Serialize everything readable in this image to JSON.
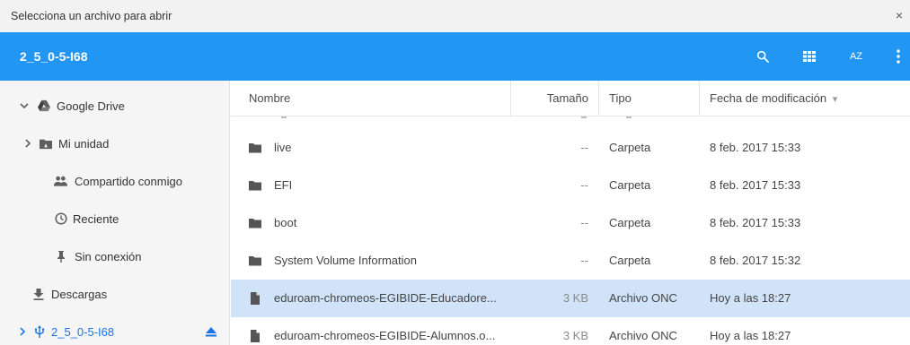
{
  "window": {
    "title": "Selecciona un archivo para abrir",
    "close_label": "×"
  },
  "toolbar": {
    "current_folder": "2_5_0-5-I68",
    "sort_label": "AZ",
    "icons": [
      "search-icon",
      "grid-view-icon",
      "sort-az-icon",
      "more-vert-icon"
    ]
  },
  "sidebar": {
    "items": [
      {
        "label": "Google Drive",
        "icon": "google-drive-icon",
        "expanded": true
      },
      {
        "label": "Mi unidad",
        "icon": "my-drive-icon",
        "expanded": false
      },
      {
        "label": "Compartido conmigo",
        "icon": "shared-people-icon"
      },
      {
        "label": "Reciente",
        "icon": "clock-icon"
      },
      {
        "label": "Sin conexión",
        "icon": "pin-icon"
      },
      {
        "label": "Descargas",
        "icon": "download-icon"
      },
      {
        "label": "2_5_0-5-I68",
        "icon": "usb-icon",
        "active": true
      }
    ]
  },
  "table": {
    "columns": {
      "name": "Nombre",
      "size": "Tamaño",
      "type": "Tipo",
      "modified": "Fecha de modificación",
      "sort_indicator": "▾"
    },
    "rows": [
      {
        "name": "live",
        "size": "--",
        "type": "Carpeta",
        "modified": "8 feb. 2017 15:33",
        "icon": "folder-icon"
      },
      {
        "name": "EFI",
        "size": "--",
        "type": "Carpeta",
        "modified": "8 feb. 2017 15:33",
        "icon": "folder-icon"
      },
      {
        "name": "boot",
        "size": "--",
        "type": "Carpeta",
        "modified": "8 feb. 2017 15:33",
        "icon": "folder-icon"
      },
      {
        "name": "System Volume Information",
        "size": "--",
        "type": "Carpeta",
        "modified": "8 feb. 2017 15:32",
        "icon": "folder-icon"
      },
      {
        "name": "eduroam-chromeos-EGIBIDE-Educadore...",
        "size": "3 KB",
        "type": "Archivo ONC",
        "modified": "Hoy a las 18:27",
        "icon": "file-icon",
        "selected": true
      },
      {
        "name": "eduroam-chromeos-EGIBIDE-Alumnos.o...",
        "size": "3 KB",
        "type": "Archivo ONC",
        "modified": "Hoy a las 18:27",
        "icon": "file-icon"
      }
    ]
  },
  "colors": {
    "accent": "#2196f3",
    "selected_row": "#d1e3f8",
    "active_nav": "#1a73e8"
  }
}
